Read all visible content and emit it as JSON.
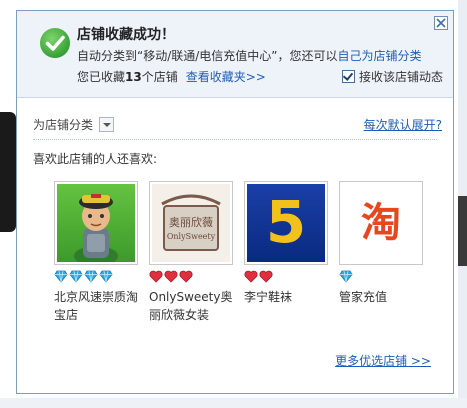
{
  "dialog": {
    "title": "店铺收藏成功！",
    "line1_text": "自动分类到“移动/联通/电信充值中心”，您还可以",
    "line1_link": "自己为店铺分类",
    "line2_prefix": "您已收藏",
    "line2_count": "13",
    "line2_suffix": "个店铺",
    "view_favorites_link": "查看收藏夹>>",
    "subscribe_label": "接收该店铺动态",
    "subscribe_checked": true
  },
  "category": {
    "label": "为店铺分类",
    "expand_link": "每次默认展开?"
  },
  "also_like": {
    "label": "喜欢此店铺的人还喜欢:",
    "shops": [
      {
        "name": "北京风速崇质淘宝店",
        "rating_icon": "blue-diamond-icon",
        "rating_count": 4
      },
      {
        "name": "OnlySweety奥丽欣薇女装",
        "rating_icon": "red-heart-icon",
        "rating_count": 3
      },
      {
        "name": "李宁鞋袜",
        "rating_icon": "red-heart-icon",
        "rating_count": 2
      },
      {
        "name": "管家充值",
        "rating_icon": "blue-diamond-icon",
        "rating_count": 1
      }
    ],
    "more_link": "更多优选店铺 >>"
  },
  "thumbs": {
    "shop2_text_top": "奥丽欣薇",
    "shop2_text_bottom": "OnlySweety",
    "shop3_glyph": "5",
    "shop4_glyph": "淘"
  },
  "colors": {
    "link": "#1f5db8",
    "success": "#3ea83e",
    "diamond": "#2aa8e8",
    "heart": "#e03040"
  }
}
